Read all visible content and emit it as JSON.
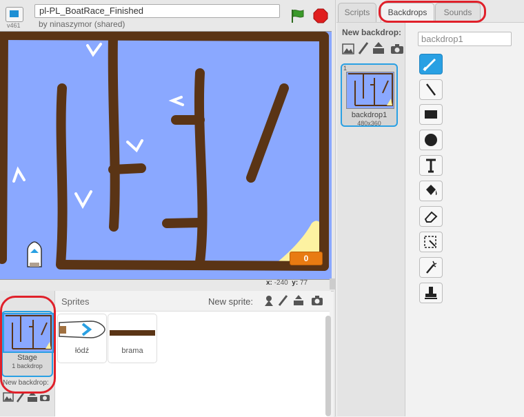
{
  "project": {
    "title": "pl-PL_BoatRace_Finished",
    "byline": "by ninaszymor (shared)",
    "version": "v461"
  },
  "stage": {
    "coords_x_label": "x:",
    "coords_x": "-240",
    "coords_y_label": "y:",
    "coords_y": "77",
    "score": "0"
  },
  "sprites_pane": {
    "title": "Sprites",
    "new_sprite_label": "New sprite:",
    "stage_tile": {
      "label": "Stage",
      "sub": "1 backdrop"
    },
    "new_backdrop_small": "New backdrop:",
    "sprites": [
      {
        "name": "łódź"
      },
      {
        "name": "brama"
      }
    ]
  },
  "tabs": [
    {
      "label": "Scripts"
    },
    {
      "label": "Backdrops"
    },
    {
      "label": "Sounds"
    }
  ],
  "backdrops_pane": {
    "new_backdrop_label": "New backdrop:",
    "backdrop": {
      "index": "1",
      "name": "backdrop1",
      "size": "480x360"
    },
    "name_input_value": "backdrop1"
  },
  "colors": {
    "water": "#8aa8ff",
    "wall": "#5a3415",
    "sand": "#fdf2a1",
    "accent": "#29a0e3",
    "highlight": "#e0202a"
  }
}
